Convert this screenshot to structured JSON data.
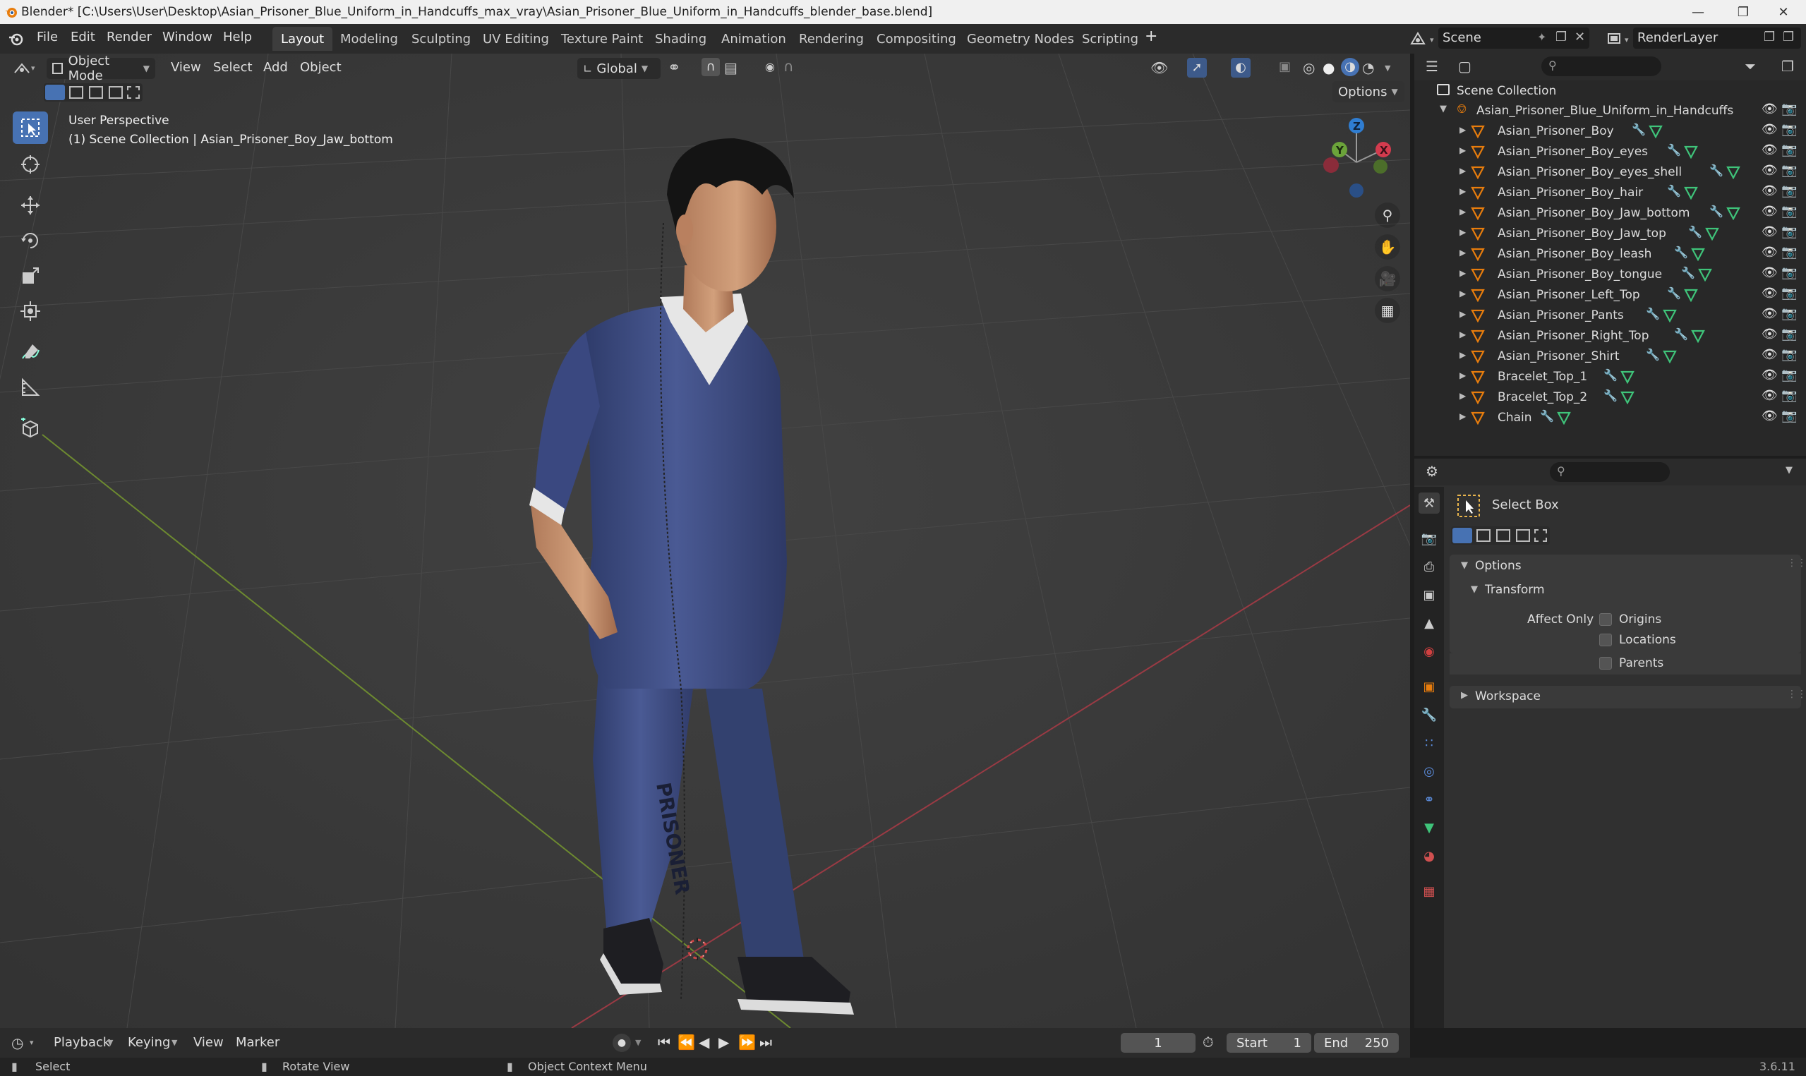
{
  "window": {
    "title": "Blender* [C:\\Users\\User\\Desktop\\Asian_Prisoner_Blue_Uniform_in_Handcuffs_max_vray\\Asian_Prisoner_Blue_Uniform_in_Handcuffs_blender_base.blend]"
  },
  "menubar": [
    "File",
    "Edit",
    "Render",
    "Window",
    "Help"
  ],
  "workspaces": [
    "Layout",
    "Modeling",
    "Sculpting",
    "UV Editing",
    "Texture Paint",
    "Shading",
    "Animation",
    "Rendering",
    "Compositing",
    "Geometry Nodes",
    "Scripting"
  ],
  "active_workspace": "Layout",
  "scene": {
    "name": "Scene",
    "view_layer": "RenderLayer"
  },
  "viewport": {
    "mode": "Object Mode",
    "menus": [
      "View",
      "Select",
      "Add",
      "Object"
    ],
    "transform_orientation": "Global",
    "options_label": "Options",
    "overlay_title": "User Perspective",
    "overlay_sub": "(1) Scene Collection | Asian_Prisoner_Boy_Jaw_bottom",
    "gizmo": {
      "z": "Z",
      "y": "Y",
      "x": "X"
    },
    "pants_text": "PRISONER"
  },
  "outliner": {
    "root": "Scene Collection",
    "collection": "Asian_Prisoner_Blue_Uniform_in_Handcuffs",
    "items": [
      "Asian_Prisoner_Boy",
      "Asian_Prisoner_Boy_eyes",
      "Asian_Prisoner_Boy_eyes_shell",
      "Asian_Prisoner_Boy_hair",
      "Asian_Prisoner_Boy_Jaw_bottom",
      "Asian_Prisoner_Boy_Jaw_top",
      "Asian_Prisoner_Boy_leash",
      "Asian_Prisoner_Boy_tongue",
      "Asian_Prisoner_Left_Top",
      "Asian_Prisoner_Pants",
      "Asian_Prisoner_Right_Top",
      "Asian_Prisoner_Shirt",
      "Bracelet_Top_1",
      "Bracelet_Top_2",
      "Chain"
    ]
  },
  "properties": {
    "tool_name": "Select Box",
    "options_label": "Options",
    "transform_label": "Transform",
    "affect_only_label": "Affect Only",
    "checkboxes": [
      "Origins",
      "Locations",
      "Parents"
    ],
    "workspace_label": "Workspace"
  },
  "timeline": {
    "menus": [
      "Playback",
      "Keying",
      "View",
      "Marker"
    ],
    "current_frame": "1",
    "start_label": "Start",
    "start": "1",
    "end_label": "End",
    "end": "250"
  },
  "statusbar": {
    "select": "Select",
    "rotate": "Rotate View",
    "context": "Object Context Menu",
    "version": "3.6.11"
  },
  "colors": {
    "accent": "#4772b3",
    "orange": "#e87d0d",
    "uniform": "#3f4f86",
    "bg": "#3b3b3b"
  }
}
